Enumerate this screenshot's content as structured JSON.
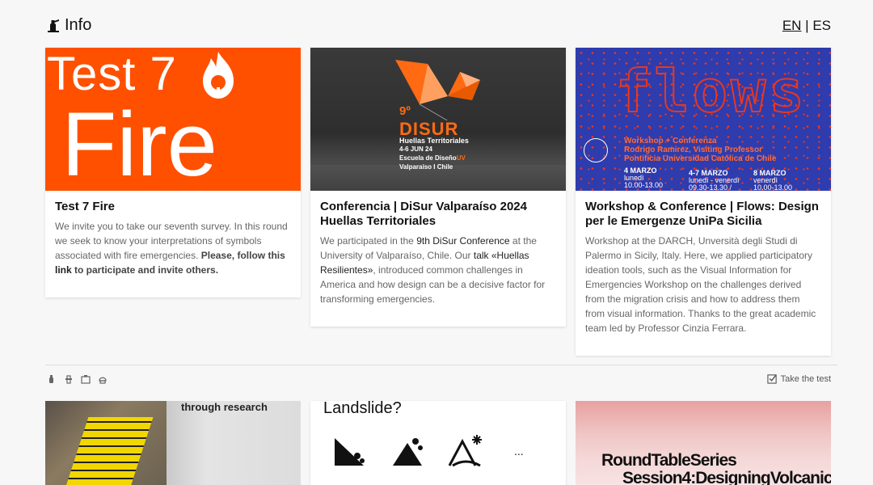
{
  "header": {
    "title": "Info",
    "lang_en": "EN",
    "lang_sep": " | ",
    "lang_es": "ES"
  },
  "cards": [
    {
      "image_title_line1": "Test 7",
      "image_title_line2": "Fire",
      "title": "Test 7 Fire",
      "text_a": "We invite you to take our seventh survey. In this round we seek to know your interpretations of symbols associated with fire emergencies. ",
      "text_bold_a": "Please, follow this ",
      "link": "link",
      "text_bold_b": " to participate and invite others."
    },
    {
      "poster_num": "9º",
      "poster_name": "DISUR",
      "poster_sub": "Huellas Territoriales",
      "poster_date": "4-6 JUN 24",
      "poster_school": "Escuela de Diseño",
      "poster_uv": "UV",
      "poster_city": "Valparaíso I Chile",
      "title": "Conferencia | DiSur Valparaíso 2024 Huellas Territoriales",
      "text_a": "We participated in the ",
      "link_a": "9th DiSur Conference",
      "text_b": " at the University of Valparaíso, Chile. Our ",
      "link_b": "talk «Huellas Resilientes»",
      "text_c": ", introduced common challenges in America and how design can be a decisive factor for transforming emergencies."
    },
    {
      "poster_word": "flows",
      "poster_line1": "Workshop + Conferenza",
      "poster_line2": "Rodrigo Ramirez, Visiting Professor",
      "poster_line3": "Pontificia Universidad Católica de Chile",
      "date1": "4 MARZO",
      "date1_day": "lunedì",
      "date1_time": "10.00-13.00",
      "date2": "4-7 MARZO",
      "date2_day": "lunedì - venerdì",
      "date2_time": "09.30-13.30 /",
      "date3": "8 MARZO",
      "date3_day": "venerdì",
      "date3_time": "10.00-13.00",
      "title": "Workshop & Conference | Flows: Design per le Emergenze UniPa Sicilia",
      "text": "Workshop at the DARCH, Unversità degli Studi di Palermo in Sicily, Italy. Here, we applied participatory ideation tools, such as the Visual Information for Emergencies Workshop on the challenges derived from the migration crisis and how to address them from visual information. Thanks to the great academic team led by Professor Cinzia Ferrara."
    }
  ],
  "toolbar": {
    "take_test": "Take the test"
  },
  "bottom": {
    "card1_text": "through research",
    "card2_title": "Landslide?",
    "card2_more": "...",
    "card3_line1": "RoundTableSeries",
    "card3_line2": "Session4:DesigningVolcanic"
  },
  "colors": {
    "fire_orange": "#ff5000",
    "disur_orange": "#ff6a13",
    "flows_blue": "#2e3cad",
    "flows_red": "#e8381f"
  }
}
